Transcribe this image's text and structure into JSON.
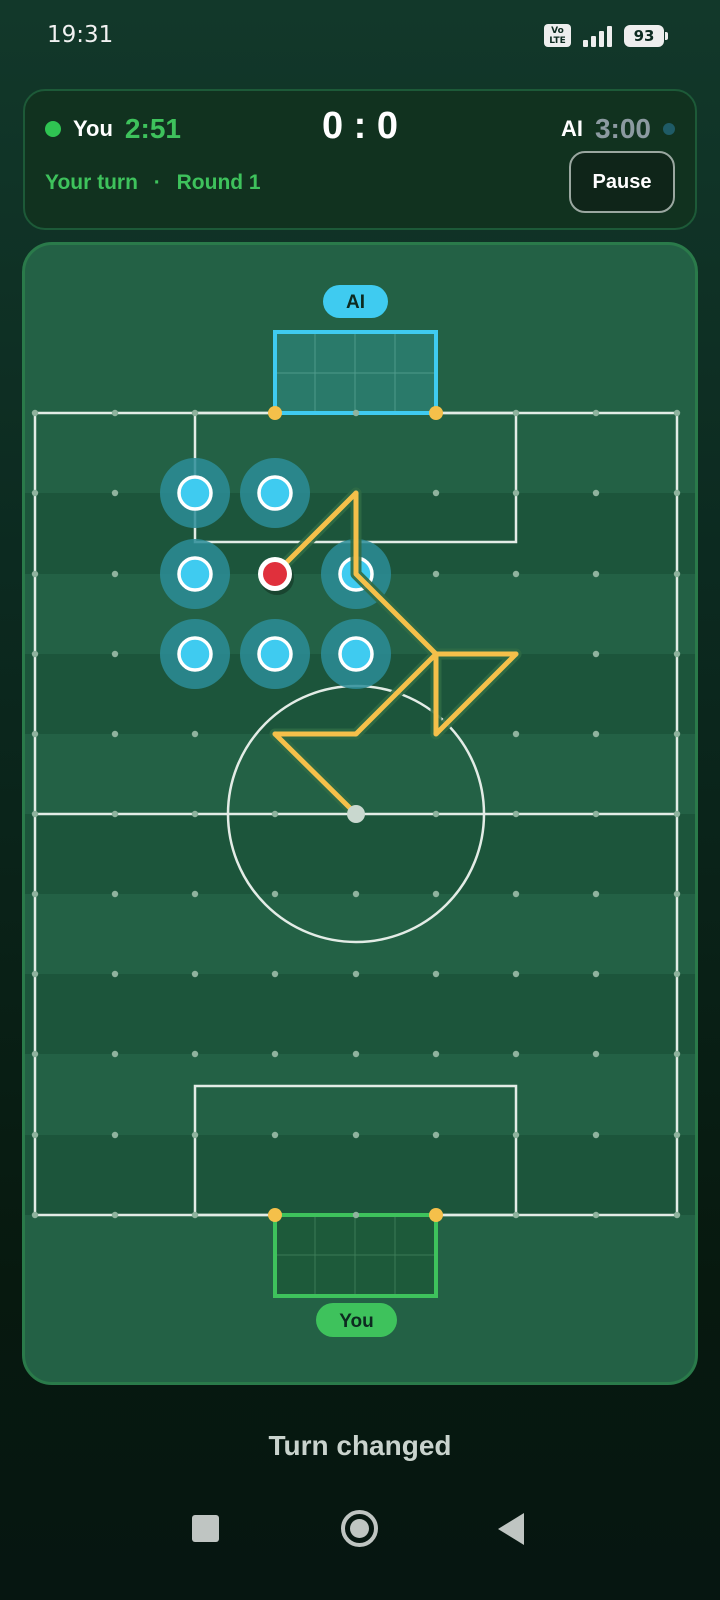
{
  "status_bar": {
    "time": "19:31",
    "volte": "Vo LTE",
    "battery": "93"
  },
  "header": {
    "player_label": "You",
    "player_timer": "2:51",
    "score": "0 : 0",
    "ai_label": "AI",
    "ai_timer": "3:00",
    "turn_text": "Your turn",
    "separator": "·",
    "round_text": "Round 1",
    "pause_label": "Pause"
  },
  "field": {
    "top_goal_label": "AI",
    "bottom_goal_label": "You",
    "colors": {
      "ai": "#3fcbf0",
      "player": "#3ec25c",
      "path": "#f5c04a",
      "ball": "#e0303c"
    }
  },
  "toast": "Turn changed",
  "nav": {
    "icons": [
      "recents-square-icon",
      "home-circle-icon",
      "back-triangle-icon"
    ]
  }
}
